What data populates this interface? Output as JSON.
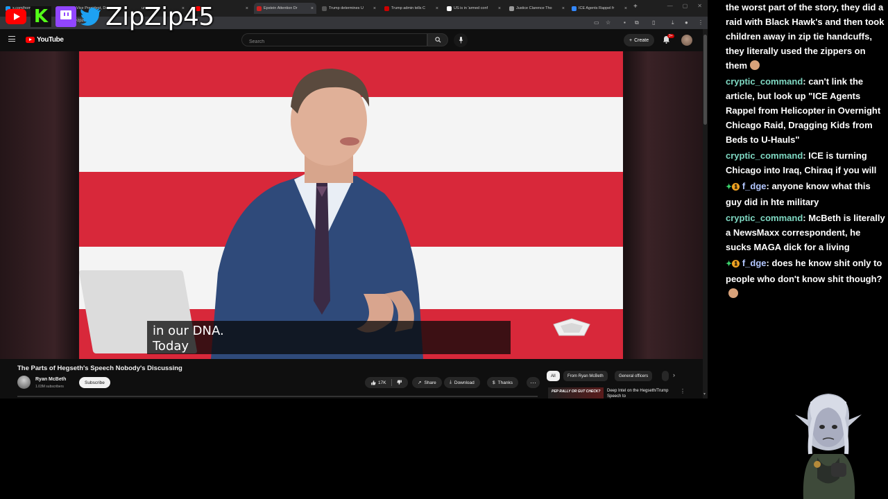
{
  "browser": {
    "tabs": [
      {
        "label": "x.com/hom",
        "color": "#1d9bf0"
      },
      {
        "label": "Vice President, Dep",
        "color": "#cc2222"
      },
      {
        "label": "ump say",
        "color": "#888888"
      },
      {
        "label": "",
        "color": "#ff0000"
      },
      {
        "label": "Epstein Attention Dr",
        "color": "#cc2222"
      },
      {
        "label": "Trump determines U",
        "color": "#555555"
      },
      {
        "label": "Trump admin tells C",
        "color": "#cc0000"
      },
      {
        "label": "US is in 'armed conf",
        "color": "#ffffff"
      },
      {
        "label": "Justice Clarence Tho",
        "color": "#999999"
      },
      {
        "label": "ICE Agents Rappel fr",
        "color": "#3388ff"
      }
    ],
    "url_fragment": "tub      atch?v=zpzlN"
  },
  "overlay": {
    "streamer_name": "ZipZip45",
    "kick_letter": "K"
  },
  "youtube": {
    "logo_text": "YouTube",
    "search_placeholder": "Search",
    "create_label": "Create",
    "notification_count": "9+"
  },
  "video": {
    "subtitle": "in our DNA.\nToday",
    "title": "The Parts of Hegseth's Speech Nobody's Discussing",
    "channel_name": "Ryan McBeth",
    "channel_subs": "1.03M subscribers",
    "subscribe_label": "Subscribe",
    "like_count": "17K",
    "share_label": "Share",
    "download_label": "Download",
    "thanks_label": "Thanks",
    "more_label": "···"
  },
  "sidebar": {
    "chips": [
      "All",
      "From Ryan McBeth",
      "General officers"
    ],
    "rec_thumb_text": "PEP RALLY OR GUT CHECK?",
    "rec_title": "Deep Intel on the Hegseth/Trump Speech to"
  },
  "chat": {
    "intro": "the worst part of the story, they did a raid with Black Hawk's and then took children away in zip tie handcuffs, they literally used the zippers on them",
    "messages": [
      {
        "user": "cryptic_command",
        "text": ": can't link the article, but look up \"ICE Agents Rappel from Helicopter in Overnight Chicago Raid, Dragging Kids from Beds to U-Hauls\"",
        "badged": false
      },
      {
        "user": "cryptic_command",
        "text": ": ICE is turning Chicago into Iraq, Chiraq if you will",
        "badged": false
      },
      {
        "user": "f_dge",
        "text": ": anyone know what this guy did in hte military",
        "badged": true
      },
      {
        "user": "cryptic_command",
        "text": ": McBeth is literally a NewsMaxx correspondent, he sucks MAGA dick for a living",
        "badged": false
      },
      {
        "user": "f_dge",
        "text": ": does he know shit only to people who don't know shit though?",
        "badged": true
      }
    ]
  },
  "colors": {
    "yt_red": "#ff0000",
    "flag_red": "#d8283a",
    "flag_white": "#f4f4f4",
    "chat_user": "#7fd9c3",
    "chat_user_alt": "#b3c7ff"
  }
}
